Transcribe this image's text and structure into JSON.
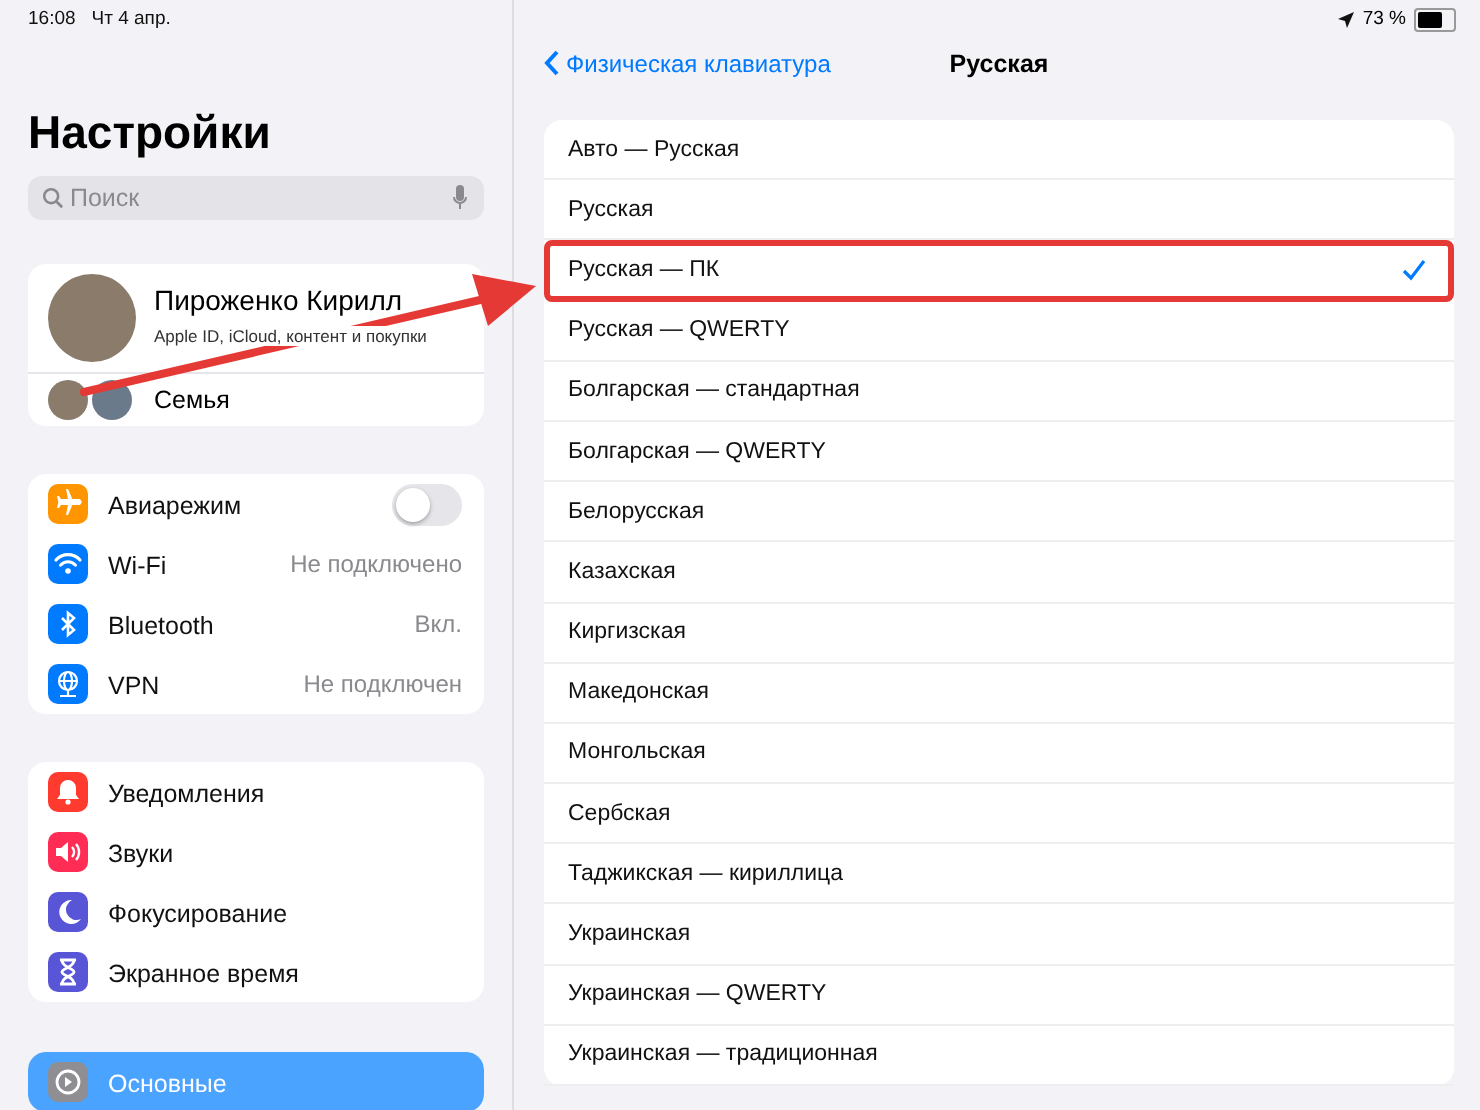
{
  "status_bar": {
    "time": "16:08",
    "date": "Чт 4 апр.",
    "battery": "73 %"
  },
  "sidebar": {
    "title": "Настройки",
    "search": {
      "placeholder": "Поиск"
    },
    "profile": {
      "name": "Пироженко Кирилл",
      "subtitle": "Apple ID, iCloud, контент и покупки",
      "family": "Семья"
    },
    "groups": [
      [
        {
          "label": "Авиарежим",
          "color": "#ff9500",
          "kind": "toggle",
          "on": false,
          "selected": false
        },
        {
          "label": "Wi-Fi",
          "color": "#007aff",
          "kind": "value",
          "value": "Не подключено",
          "selected": false
        },
        {
          "label": "Bluetooth",
          "color": "#007aff",
          "kind": "value",
          "value": "Вкл.",
          "selected": false
        },
        {
          "label": "VPN",
          "color": "#007aff",
          "kind": "value",
          "value": "Не подключен",
          "selected": false
        }
      ],
      [
        {
          "label": "Уведомления",
          "color": "#ff3b30",
          "kind": "link",
          "selected": false
        },
        {
          "label": "Звуки",
          "color": "#ff2d55",
          "kind": "link",
          "selected": false
        },
        {
          "label": "Фокусирование",
          "color": "#5856d6",
          "kind": "link",
          "selected": false
        },
        {
          "label": "Экранное время",
          "color": "#5856d6",
          "kind": "link",
          "selected": false
        }
      ],
      [
        {
          "label": "Основные",
          "color": "#8e8e93",
          "kind": "link",
          "selected": true
        }
      ]
    ]
  },
  "detail": {
    "back": "Физическая клавиатура",
    "title": "Русская",
    "layouts": [
      {
        "label": "Авто — Русская",
        "selected": false,
        "highlighted": false
      },
      {
        "label": "Русская",
        "selected": false,
        "highlighted": false
      },
      {
        "label": "Русская — ПК",
        "selected": true,
        "highlighted": true
      },
      {
        "label": "Русская — QWERTY",
        "selected": false,
        "highlighted": false
      },
      {
        "label": "Болгарская — стандартная",
        "selected": false,
        "highlighted": false
      },
      {
        "label": "Болгарская — QWERTY",
        "selected": false,
        "highlighted": false
      },
      {
        "label": "Белорусская",
        "selected": false,
        "highlighted": false
      },
      {
        "label": "Казахская",
        "selected": false,
        "highlighted": false
      },
      {
        "label": "Киргизская",
        "selected": false,
        "highlighted": false
      },
      {
        "label": "Македонская",
        "selected": false,
        "highlighted": false
      },
      {
        "label": "Монгольская",
        "selected": false,
        "highlighted": false
      },
      {
        "label": "Сербская",
        "selected": false,
        "highlighted": false
      },
      {
        "label": "Таджикская — кириллица",
        "selected": false,
        "highlighted": false
      },
      {
        "label": "Украинская",
        "selected": false,
        "highlighted": false
      },
      {
        "label": "Украинская — QWERTY",
        "selected": false,
        "highlighted": false
      },
      {
        "label": "Украинская — традиционная",
        "selected": false,
        "highlighted": false
      }
    ]
  }
}
